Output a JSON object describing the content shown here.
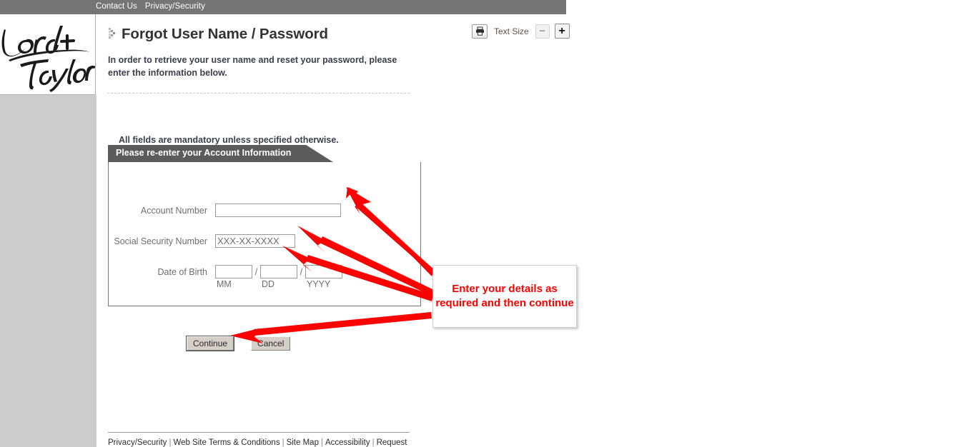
{
  "top_bar": {
    "links": [
      {
        "label": "Contact Us",
        "name": "contact-us"
      },
      {
        "label": "Privacy/Security",
        "name": "privacy-security"
      }
    ]
  },
  "logo": {
    "name": "lord-and-taylor-logo",
    "line1": "Lord +",
    "line2": "Taylor"
  },
  "header": {
    "title": "Forgot User Name / Password",
    "intro": "In order to retrieve your user name and reset your password, please enter the information below."
  },
  "toolbar": {
    "print_icon": "printer-icon",
    "text_size_label": "Text Size",
    "decrease_label": "−",
    "increase_label": "+"
  },
  "form": {
    "mandatory_note": "All fields are mandatory unless specified otherwise.",
    "panel_title": "Please re-enter your Account Information",
    "fields": [
      {
        "label": "Account Number",
        "value": "",
        "placeholder": ""
      },
      {
        "label": "Social Security Number",
        "value": "XXX-XX-XXXX",
        "placeholder": "XXX-XX-XXXX"
      }
    ],
    "dob": {
      "label": "Date of Birth",
      "separator": "/",
      "month": {
        "value": "",
        "hint": "MM"
      },
      "day": {
        "value": "",
        "hint": "DD"
      },
      "year": {
        "value": "",
        "hint": "YYYY"
      }
    },
    "buttons": {
      "continue": "Continue",
      "cancel": "Cancel"
    }
  },
  "footer": {
    "links": [
      "Privacy/Security",
      "Web Site Terms & Conditions",
      "Site Map",
      "Accessibility",
      "Request"
    ],
    "separator": "|"
  },
  "annotation": {
    "callout_text": "Enter your details as required and then continue",
    "color": "#ff0000",
    "arrow_count": 4
  },
  "colors": {
    "top_bar": "#757575",
    "left_rail": "#cccccc",
    "panel_header": "#5b5b5b",
    "annotation_red": "#ff0000",
    "label_gray": "#6e6e6e",
    "text_dark": "#3a3f4a"
  }
}
